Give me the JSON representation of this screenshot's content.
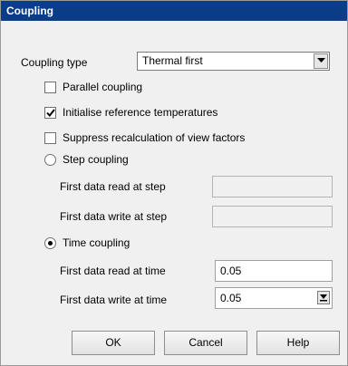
{
  "window": {
    "title": "Coupling"
  },
  "coupling_type": {
    "label": "Coupling type",
    "selected": "Thermal first"
  },
  "options": {
    "parallel_coupling": {
      "label": "Parallel coupling",
      "checked": false
    },
    "initialise_reference_temperatures": {
      "label": "Initialise reference temperatures",
      "checked": true
    },
    "suppress_recalculation": {
      "label": "Suppress recalculation of view factors",
      "checked": false
    }
  },
  "step_coupling": {
    "label": "Step coupling",
    "selected": false,
    "read_label": "First data read at step",
    "read_value": "",
    "write_label": "First data write at step",
    "write_value": ""
  },
  "time_coupling": {
    "label": "Time coupling",
    "selected": true,
    "read_label": "First data read at time",
    "read_value": "0.05",
    "write_label": "First data write at time",
    "write_value": "0.05"
  },
  "buttons": {
    "ok": "OK",
    "cancel": "Cancel",
    "help": "Help"
  },
  "icons": {
    "dropdown": "chevron-down-icon",
    "checkmark": "checkmark-icon",
    "spinner": "spin-down-icon"
  },
  "colors": {
    "titlebar": "#0b3c86",
    "title_text": "#ffffff",
    "dialog_bg": "#f0f0f0"
  }
}
